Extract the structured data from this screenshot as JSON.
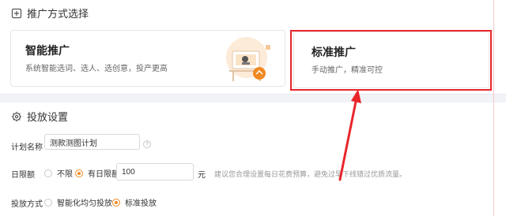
{
  "promotion_method": {
    "section_title": "推广方式选择",
    "smart_card": {
      "title": "智能推广",
      "description": "系统智能选词、选人、选创意，投产更高"
    },
    "standard_card": {
      "title": "标准推广",
      "description": "手动推广，精准可控"
    }
  },
  "delivery_settings": {
    "section_title": "投放设置",
    "plan_name": {
      "label": "计划名称",
      "value": "测款测图计划"
    },
    "daily_budget": {
      "label": "日限额",
      "options": [
        "不限",
        "有日限额"
      ],
      "selected": "有日限额",
      "value": "100",
      "unit": "元",
      "hint": "建议您合理设置每日花费预算，避免过早下线错过优质流量。"
    },
    "delivery_method": {
      "label": "投放方式",
      "options": [
        "智能化均匀投放",
        "标准投放"
      ],
      "selected": "标准投放"
    }
  },
  "colors": {
    "accent": "#f08a24",
    "highlight": "#e8262a"
  }
}
